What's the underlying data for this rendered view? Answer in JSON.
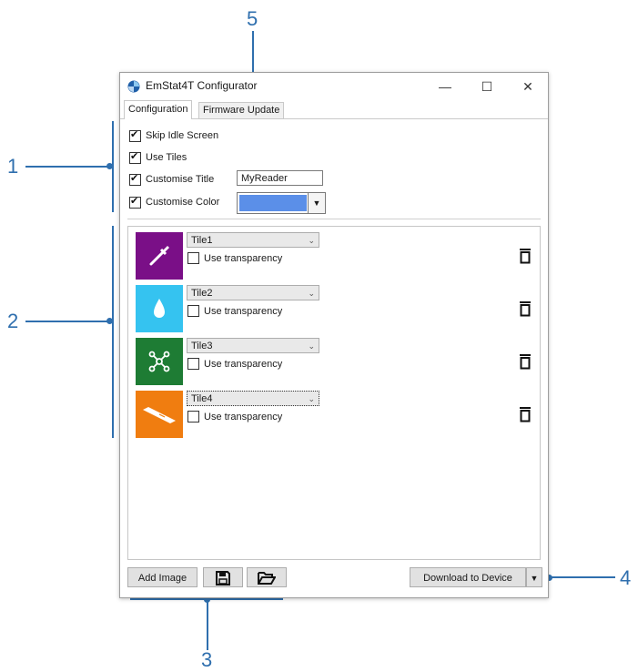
{
  "window": {
    "title": "EmStat4T Configurator",
    "controls": {
      "minimize": "—",
      "maximize": "☐",
      "close": "✕"
    }
  },
  "tabs": [
    {
      "label": "Configuration",
      "active": true
    },
    {
      "label": "Firmware Update",
      "active": false
    }
  ],
  "options": {
    "skip_idle_label": "Skip Idle Screen",
    "skip_idle_checked": true,
    "use_tiles_label": "Use Tiles",
    "use_tiles_checked": true,
    "custom_title_label": "Customise Title",
    "custom_title_checked": true,
    "custom_title_value": "MyReader",
    "custom_color_label": "Customise Color",
    "custom_color_checked": true,
    "custom_color_value": "#5b8fe8"
  },
  "tiles": [
    {
      "name": "Tile1",
      "transparency_label": "Use transparency",
      "use_transparency": false,
      "color": "#7a0f87",
      "icon": "pipette-icon"
    },
    {
      "name": "Tile2",
      "transparency_label": "Use transparency",
      "use_transparency": false,
      "color": "#35c3f0",
      "icon": "droplet-icon"
    },
    {
      "name": "Tile3",
      "transparency_label": "Use transparency",
      "use_transparency": false,
      "color": "#1e7c34",
      "icon": "network-icon"
    },
    {
      "name": "Tile4",
      "transparency_label": "Use transparency",
      "use_transparency": false,
      "color": "#f07d10",
      "icon": "sensor-strip-icon"
    }
  ],
  "bottom_bar": {
    "add_image_label": "Add Image",
    "save_icon": "floppy-disk-icon",
    "open_icon": "folder-open-icon",
    "download_label": "Download to Device"
  },
  "callouts": [
    "1",
    "2",
    "3",
    "4",
    "5"
  ],
  "colors": {
    "callout": "#2f6fae"
  }
}
